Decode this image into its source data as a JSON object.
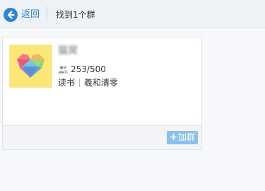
{
  "header": {
    "back_label": "返回",
    "title": "找到1个群"
  },
  "group": {
    "name": "猫窝",
    "members": "253/500",
    "tags": [
      "读书",
      "羲和清零"
    ],
    "join_label": "加群",
    "join_icon": "+"
  },
  "colors": {
    "accent": "#2f86d3",
    "join_button": "#8dc1ec",
    "avatar_bg": "#fbe676"
  }
}
